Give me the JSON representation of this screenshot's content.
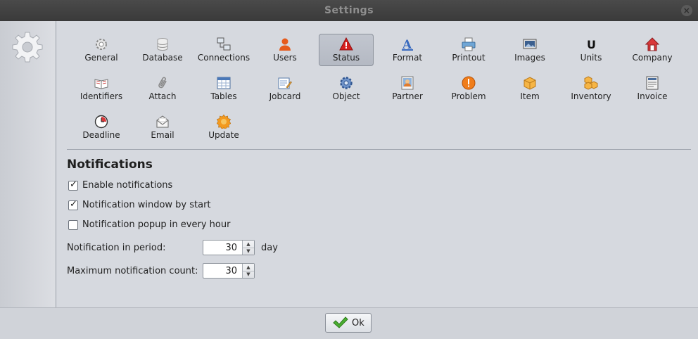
{
  "window": {
    "title": "Settings"
  },
  "categories": [
    {
      "label": "General",
      "icon": "gear-icon"
    },
    {
      "label": "Database",
      "icon": "database-icon"
    },
    {
      "label": "Connections",
      "icon": "connections-icon"
    },
    {
      "label": "Users",
      "icon": "user-icon"
    },
    {
      "label": "Status",
      "icon": "warning-icon"
    },
    {
      "label": "Format",
      "icon": "font-icon"
    },
    {
      "label": "Printout",
      "icon": "printer-icon"
    },
    {
      "label": "Images",
      "icon": "image-icon"
    },
    {
      "label": "Units",
      "icon": "units-icon"
    },
    {
      "label": "Company",
      "icon": "house-icon"
    },
    {
      "label": "Identifiers",
      "icon": "book-icon"
    },
    {
      "label": "Attach",
      "icon": "paperclip-icon"
    },
    {
      "label": "Tables",
      "icon": "table-icon"
    },
    {
      "label": "Jobcard",
      "icon": "jobcard-icon"
    },
    {
      "label": "Object",
      "icon": "cog-blue-icon"
    },
    {
      "label": "Partner",
      "icon": "partner-card-icon"
    },
    {
      "label": "Problem",
      "icon": "exclamation-icon"
    },
    {
      "label": "Item",
      "icon": "box-icon"
    },
    {
      "label": "Inventory",
      "icon": "boxes-icon"
    },
    {
      "label": "Invoice",
      "icon": "invoice-icon"
    },
    {
      "label": "Deadline",
      "icon": "clock-icon"
    },
    {
      "label": "Email",
      "icon": "envelope-icon"
    },
    {
      "label": "Update",
      "icon": "update-icon"
    }
  ],
  "selected_category": "Status",
  "notifications": {
    "title": "Notifications",
    "enable_label": "Enable notifications",
    "enable_checked": true,
    "window_by_start_label": "Notification window by start",
    "window_by_start_checked": true,
    "popup_every_hour_label": "Notification popup in every hour",
    "popup_every_hour_checked": false,
    "period_label": "Notification in period:",
    "period_value": "30",
    "period_unit": "day",
    "max_count_label": "Maximum notification count:",
    "max_count_value": "30"
  },
  "footer": {
    "ok_label": "Ok"
  }
}
